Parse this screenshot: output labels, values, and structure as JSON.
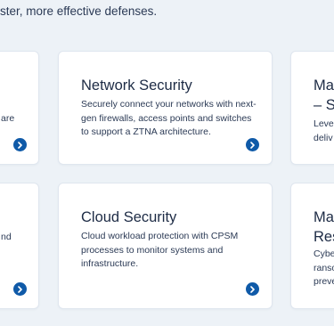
{
  "intro": {
    "text": "ster, more effective defenses."
  },
  "cards": {
    "left_top": {
      "desc_lines": [
        "are"
      ],
      "arrow_icon": "chevron-right-icon"
    },
    "network_security": {
      "title": "Network Security",
      "description": "Securely connect your networks with next-gen firewalls, access points and switches to support a ZTNA architecture.",
      "arrow_icon": "chevron-right-icon"
    },
    "right_top": {
      "title_lines": [
        "Mar",
        "– S"
      ],
      "desc_lines": [
        "Leve",
        "deliv"
      ]
    },
    "left_bottom": {
      "desc_lines": [
        "nd"
      ],
      "arrow_icon": "chevron-right-icon"
    },
    "cloud_security": {
      "title": "Cloud Security",
      "description": "Cloud workload protection with CPSM processes to monitor systems and infrastructure.",
      "arrow_icon": "chevron-right-icon"
    },
    "right_bottom": {
      "title_lines": [
        "Mar",
        "Res"
      ],
      "desc_lines": [
        "Cybe",
        "ranso",
        "preve"
      ]
    }
  },
  "colors": {
    "background": "#edf2f7",
    "card": "#ffffff",
    "accent": "#0f5aa8",
    "text": "#1d2b45"
  }
}
